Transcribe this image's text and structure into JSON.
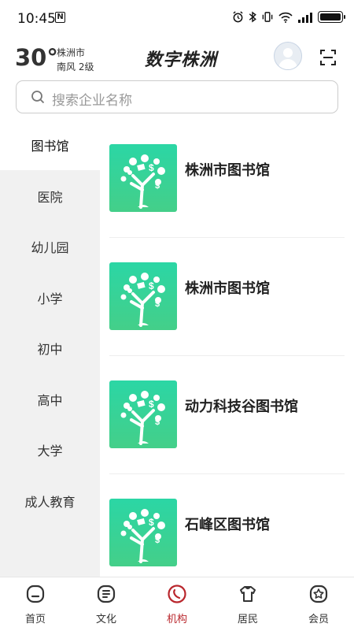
{
  "status_bar": {
    "time": "10:45",
    "nfc": "N"
  },
  "header": {
    "temperature": "30°",
    "city": "株洲市",
    "wind": "南风  2级",
    "brand": "数字株洲"
  },
  "search": {
    "placeholder": "搜索企业名称"
  },
  "sidebar": {
    "active_index": 0,
    "items": [
      "图书馆",
      "医院",
      "幼儿园",
      "小学",
      "初中",
      "高中",
      "大学",
      "成人教育"
    ]
  },
  "list": {
    "items": [
      {
        "title": "株洲市图书馆"
      },
      {
        "title": "株洲市图书馆"
      },
      {
        "title": "动力科技谷图书馆"
      },
      {
        "title": "石峰区图书馆"
      }
    ]
  },
  "tabbar": {
    "active_index": 2,
    "accent_color": "#b9262c",
    "items": [
      {
        "label": "首页",
        "icon": "home-icon"
      },
      {
        "label": "文化",
        "icon": "culture-icon"
      },
      {
        "label": "机构",
        "icon": "institution-icon"
      },
      {
        "label": "居民",
        "icon": "resident-icon"
      },
      {
        "label": "会员",
        "icon": "member-icon"
      }
    ]
  }
}
